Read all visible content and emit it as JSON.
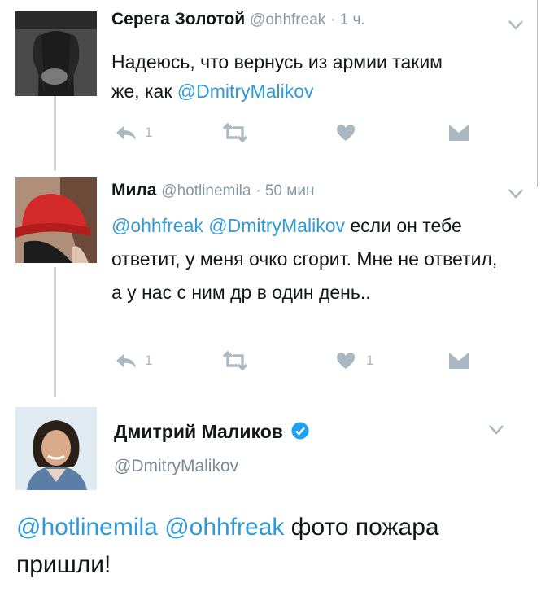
{
  "tweet1": {
    "name": "Серега Золотой",
    "handle": "@ohhfreak",
    "time": "· 1 ч.",
    "text_plain": "Надеюсь, что вернусь из армии таким же, как ",
    "text_mention": "@DmitryMalikov",
    "reply_count": "1"
  },
  "tweet2": {
    "name": "Мила",
    "handle": "@hotlinemila",
    "time": "· 50 мин",
    "mention1": "@ohhfreak",
    "mention2": "@DmitryMalikov",
    "text_rest": " если он тебе ответит, у меня очко сгорит. Мне не ответил, а у нас с ним др в один день..",
    "reply_count": "1",
    "like_count": "1"
  },
  "main_tweet": {
    "name": "Дмитрий Маликов",
    "handle": "@DmitryMalikov",
    "mention1": "@hotlinemila",
    "mention2": "@ohhfreak",
    "text_rest": " фото пожара пришли!"
  },
  "colors": {
    "mention": "#2f9ad8",
    "verified": "#1da1f2",
    "icon": "#aab8c2"
  }
}
